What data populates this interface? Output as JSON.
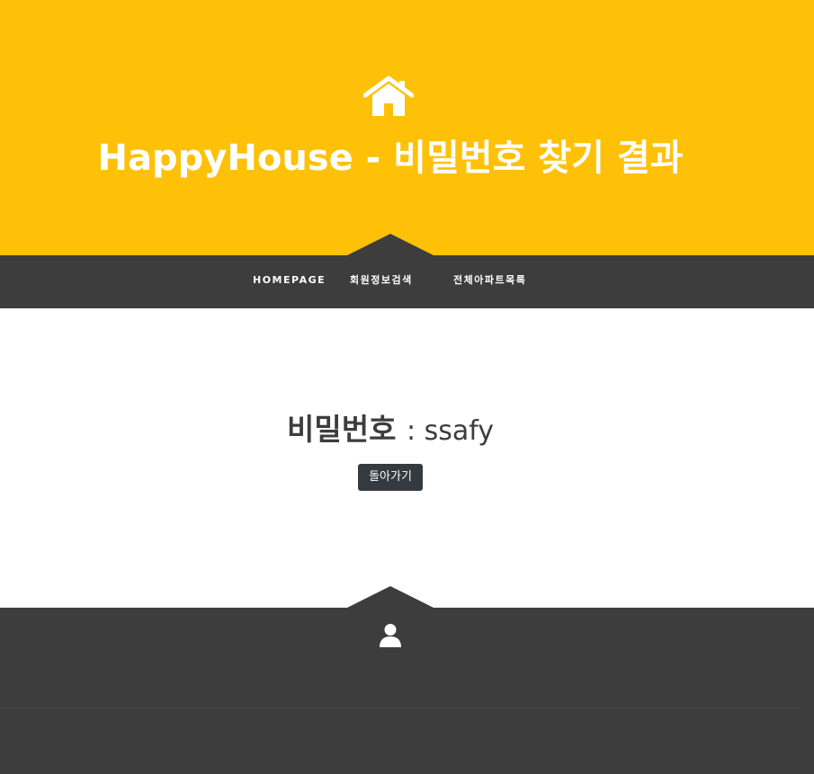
{
  "hero": {
    "icon": "home-icon",
    "title": "HappyHouse - 비밀번호 찾기 결과",
    "background_color": "#ffc107"
  },
  "nav": {
    "items": [
      {
        "label": "HOMEPAGE"
      },
      {
        "label": "회원정보검색"
      },
      {
        "label": "전체아파트목록"
      }
    ],
    "background_color": "#3d3d3d"
  },
  "main": {
    "result_label": "비밀번호",
    "result_value": ": ssafy",
    "back_button_label": "돌아가기"
  },
  "footer": {
    "icon": "user-icon",
    "background_color": "#3d3d3d"
  }
}
